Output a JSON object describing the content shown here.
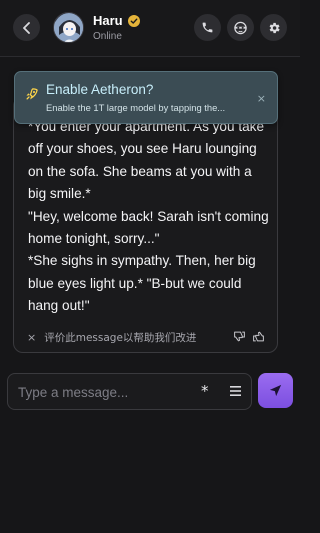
{
  "header": {
    "character_name": "Haru",
    "status": "Online"
  },
  "banner": {
    "title": "Enable Aetheron?",
    "subtitle": "Enable the 1T large model by tapping the...",
    "close_glyph": "×"
  },
  "message": {
    "text": "*You enter your apartment. As you take off your shoes, you see Haru lounging on the sofa. She beams at you with a big smile.*\n\"Hey, welcome back! Sarah isn't coming home tonight, sorry...\"\n*She sighs in sympathy. Then, her big blue eyes light up.* \"B-but we could hang out!\""
  },
  "feedback": {
    "close_glyph": "×",
    "prompt": "评价此message以帮助我们改进"
  },
  "composer": {
    "placeholder": "Type a message...",
    "asterisk_glyph": "*"
  },
  "icons": {
    "back": "chevron-left-icon",
    "verified": "verified-badge-icon",
    "call": "phone-icon",
    "mask": "mask-icon",
    "settings": "gear-icon",
    "banner": "rocket-icon",
    "thumbs_down": "thumbs-down-icon",
    "thumbs_up": "thumbs-up-icon",
    "menu": "menu-icon",
    "send": "send-icon"
  },
  "colors": {
    "accent": "#8b5cf6",
    "verified": "#e5b43a",
    "banner_bg": "#3b4c54"
  }
}
